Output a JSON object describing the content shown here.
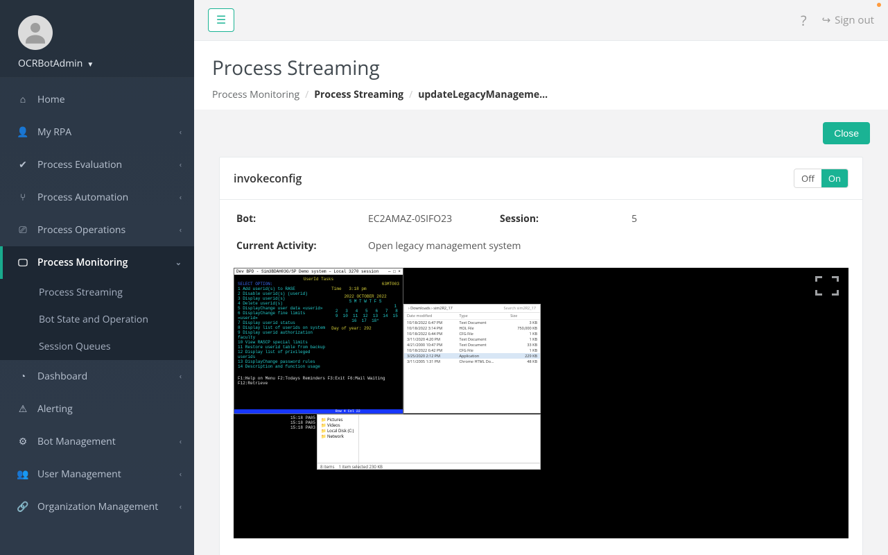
{
  "user": {
    "name": "OCRBotAdmin"
  },
  "nav": {
    "home": "Home",
    "my_rpa": "My RPA",
    "process_evaluation": "Process Evaluation",
    "process_automation": "Process Automation",
    "process_operations": "Process Operations",
    "process_monitoring": "Process Monitoring",
    "monitoring_sub": {
      "process_streaming": "Process Streaming",
      "bot_state": "Bot State and Operation",
      "session_queues": "Session Queues"
    },
    "dashboard": "Dashboard",
    "alerting": "Alerting",
    "bot_management": "Bot Management",
    "user_management": "User Management",
    "org_management": "Organization Management"
  },
  "topbar": {
    "signout": "Sign out"
  },
  "page": {
    "title": "Process Streaming",
    "breadcrumb": {
      "a": "Process Monitoring",
      "b": "Process Streaming",
      "c": "updateLegacyManageme…"
    },
    "close_btn": "Close"
  },
  "panel": {
    "title": "invokeconfig",
    "toggle_off": "Off",
    "toggle_on": "On",
    "labels": {
      "bot": "Bot:",
      "session": "Session:",
      "activity": "Current Activity:"
    },
    "values": {
      "bot": "EC2AMAZ-0SIFO23",
      "session": "5",
      "activity": "Open legacy management system"
    }
  },
  "stream": {
    "terminal": {
      "title": "Dev BPD - Sim3BDAH03G/SP Demo system – Local 3270 session",
      "title_right": "— □ ×",
      "header": "UserId Tasks",
      "clock_label": "Time",
      "clock_value": "3:18 pm",
      "corner_num": "63MT003",
      "menu_head": "SELECT OPTION:",
      "menu": [
        "1  Add userid(s) to RASE",
        "2  Disable userid(s)  (userid)",
        "3  Display userid(s)",
        "4  Delete userid(s)",
        "5  DisplayChange user data  «userid»",
        "6  DisplayChange fine limits «userid»",
        "7  Display userid status",
        "8  Display list of userids on system",
        "9  Display userid authorization faculty",
        "10 View RASCP special limits",
        "11 Restore userid table from backup",
        "12 Display list of privileged userids",
        "13 DisplayChange password rules",
        "14 Description and function usage"
      ],
      "calendar_head": "2022    OCTOBER    2022",
      "calendar_days": "S   M   T   W   T   F   S",
      "calendar_rows": [
        "                        1",
        " 2   3   4   5   6   7   8",
        " 9  10  11  12  13  14  15",
        "16  17  18*"
      ],
      "day_of_year": "Day of year:  292",
      "fn_keys": "F1:Help on Menu  F2:Todays Reminders  F3:Exit  F6:Mail Waiting  F12:Retrieve",
      "status_right": "Row 4 Col 22"
    },
    "timelog_lines": [
      "15:18 PA05",
      "15:18 PA05",
      "15:18 PA03"
    ],
    "explorer_small": {
      "tree": [
        "Pictures",
        "Videos",
        "Local Disk (C:)",
        "Network"
      ],
      "footer_left": "8 items",
      "footer_right": "1 item selected  230 KB"
    },
    "explorer_files": {
      "breadcrumb": "› Downloads › sim2R2_17",
      "search": "Search sim2R2_17",
      "columns": [
        "Date modified",
        "Type",
        "Size"
      ],
      "rows": [
        {
          "date": "10/18/2022 6:47 PM",
          "type": "Text Document",
          "size": "3 KB"
        },
        {
          "date": "10/18/2022 3:14 PM",
          "type": "HOL File",
          "size": "750,000 KB"
        },
        {
          "date": "10/18/2022 6:44 PM",
          "type": "CFG File",
          "size": "1 KB"
        },
        {
          "date": "3/11/2020 4:20 PM",
          "type": "Text Document",
          "size": "1 KB"
        },
        {
          "date": "4/21/2000 10:47 PM",
          "type": "Text Document",
          "size": "33 KB"
        },
        {
          "date": "10/18/2022 6:42 PM",
          "type": "CFG File",
          "size": "1 KB"
        },
        {
          "date": "3/25/2020 2:12 PM",
          "type": "Application",
          "size": "229 KB",
          "selected": true
        },
        {
          "date": "3/11/2005 1:31 PM",
          "type": "Chrome HTML Do…",
          "size": "48 KB"
        }
      ]
    }
  }
}
